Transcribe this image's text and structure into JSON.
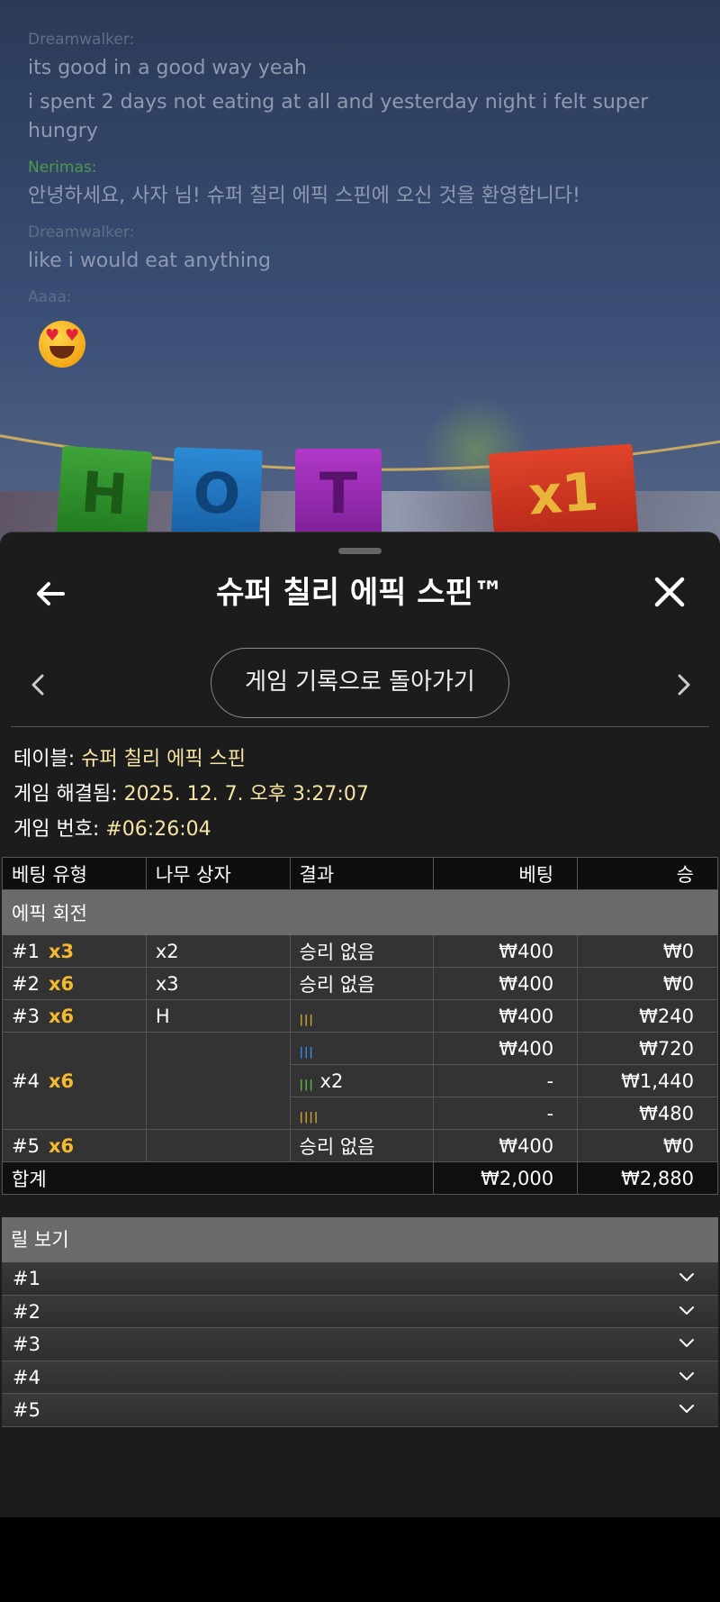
{
  "chat": {
    "messages": [
      {
        "author": "Dreamwalker:",
        "lines": [
          "its good in a good way yeah",
          "i spent 2 days not eating at all and yesterday night i felt super hungry"
        ]
      },
      {
        "author": "Nerimas:",
        "lines": [
          "안녕하세요, 사자 님! 슈퍼 칠리 에픽 스핀에 오신 것을 환영합니다!"
        ]
      },
      {
        "author": "Dreamwalker:",
        "lines": [
          "like i would eat anything"
        ]
      },
      {
        "author": "Aaaa:",
        "emoji": "heart-eyes-emoji"
      }
    ]
  },
  "scene": {
    "flags": [
      "H",
      "O",
      "T",
      "x1"
    ]
  },
  "panel": {
    "title": "슈퍼 칠리 에픽 스핀™",
    "history_button": "게임 기록으로 돌아가기",
    "info": {
      "table_label": "테이블:",
      "table_value": "슈퍼 칠리 에픽 스핀",
      "resolved_label": "게임 해결됨:",
      "resolved_value": "2025. 12. 7. 오후 3:27:07",
      "game_no_label": "게임 번호:",
      "game_no_value": "#06:26:04"
    },
    "table": {
      "headers": [
        "베팅 유형",
        "나무 상자",
        "결과",
        "베팅",
        "승"
      ],
      "section": "에픽 회전",
      "rows": [
        {
          "id": "#1",
          "mult": "x3",
          "box": "x2",
          "result": "승리 없음",
          "bet": "₩400",
          "win": "₩0"
        },
        {
          "id": "#2",
          "mult": "x6",
          "box": "x3",
          "result": "승리 없음",
          "bet": "₩400",
          "win": "₩0"
        },
        {
          "id": "#3",
          "mult": "x6",
          "box": "H",
          "result_symbols": "yellow-chili x3",
          "bet": "₩400",
          "win": "₩240"
        },
        {
          "id": "#4",
          "mult": "x6",
          "box": "",
          "sub": [
            {
              "result_symbols": "blue-chili x3",
              "extra": "",
              "bet": "₩400",
              "win": "₩720"
            },
            {
              "result_symbols": "green-chili x3",
              "extra": "x2",
              "bet": "-",
              "win": "₩1,440"
            },
            {
              "result_symbols": "yellow-chili x4",
              "extra": "",
              "bet": "-",
              "win": "₩480"
            }
          ]
        },
        {
          "id": "#5",
          "mult": "x6",
          "box": "",
          "result": "승리 없음",
          "bet": "₩400",
          "win": "₩0"
        }
      ],
      "total_label": "합계",
      "total_bet": "₩2,000",
      "total_win": "₩2,880"
    },
    "reels": {
      "header": "릴 보기",
      "items": [
        "#1",
        "#2",
        "#3",
        "#4",
        "#5"
      ]
    }
  },
  "colors": {
    "multiplier": "#f5b930",
    "info_value": "#f7e4a4",
    "panel_bg": "#1c1c1c"
  }
}
